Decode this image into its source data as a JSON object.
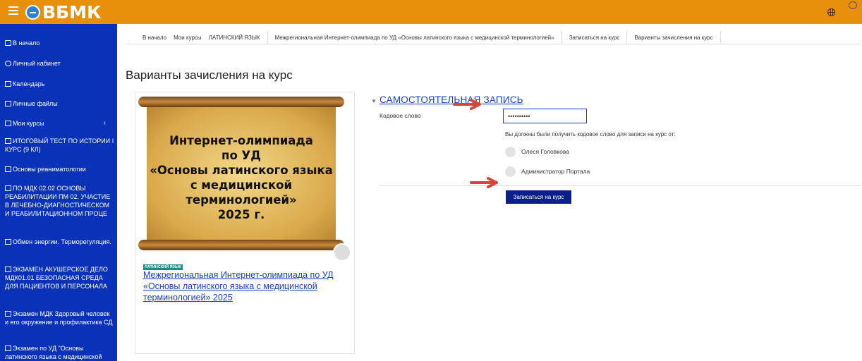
{
  "header": {
    "logo_text": "ВБМК",
    "menu_icon": "hamburger-icon",
    "language_icon": "globe-icon",
    "messages_icon": "chat-icon",
    "brand_color": "#e8900c"
  },
  "sidebar": {
    "background_color": "#0a32b8",
    "items": [
      {
        "label": "В начало",
        "icon": "home-icon"
      },
      {
        "label": "Личный кабинет",
        "icon": "dashboard-icon"
      },
      {
        "label": "Календарь",
        "icon": "calendar-icon"
      },
      {
        "label": "Личные файлы",
        "icon": "file-icon"
      },
      {
        "label": "Мои курсы",
        "icon": "graduation-cap-icon"
      },
      {
        "label": "ИТОГОВЫЙ ТЕСТ ПО ИСТОРИИ I КУРС (9 КЛ)",
        "icon": "folder-icon"
      },
      {
        "label": "Основы реаниматологии",
        "icon": "folder-icon"
      },
      {
        "label": "ПО МДК 02.02 ОСНОВЫ РЕАБИЛИТАЦИИ ПМ 02. УЧАСТИЕ В ЛЕЧЕБНО-ДИАГНОСТИЧЕСКОМ И РЕАБИЛИТАЦИОННОМ ПРОЦЕ",
        "icon": "folder-icon"
      },
      {
        "label": "Обмен энергии. Терморегуляция.",
        "icon": "folder-icon"
      },
      {
        "label": "ЭКЗАМЕН АКУШЕРСКОЕ ДЕЛО МДК01.01 БЕЗОПАСНАЯ СРЕДА ДЛЯ ПАЦИЕНТОВ И ПЕРСОНАЛА",
        "icon": "folder-icon"
      },
      {
        "label": "Экзамен МДК Здоровый человек и его окружение и профилактика СД",
        "icon": "folder-icon"
      },
      {
        "label": "Экзамен по УД \"Основы латинского языка с медицинской",
        "icon": "folder-icon"
      }
    ]
  },
  "breadcrumb": [
    "В начало",
    "Мои курсы",
    "ЛАТИНСКИЙ ЯЗЫК",
    "Межрегиональная Интернет-олимпиада по УД «Основы латинского языка с медицинской терминологией»",
    "Записаться на курс",
    "Варианты зачисления на курс"
  ],
  "page_title": "Варианты зачисления на курс",
  "course_card": {
    "image_lines": [
      "Интернет-олимпиада",
      "по УД",
      "«Основы латинского языка",
      "с медицинской",
      "терминологией»",
      "2025 г."
    ],
    "category_badge": "ЛАТИНСКИЙ ЯЗЫК",
    "title": "Межрегиональная Интернет-олимпиада по УД «Основы латинского языка с медицинской терминологией» 2025"
  },
  "self_enrolment": {
    "section_title": "САМОСТОЯТЕЛЬНАЯ ЗАПИСЬ",
    "keyword_label": "Кодовое слово",
    "keyword_value": "••••••••••",
    "info_text": "Вы должны были получить кодовое слово для записи на курс от:",
    "teachers": [
      "Олеся Головкова",
      "Администратор Портала"
    ],
    "enrol_button": "Записаться на курс"
  }
}
